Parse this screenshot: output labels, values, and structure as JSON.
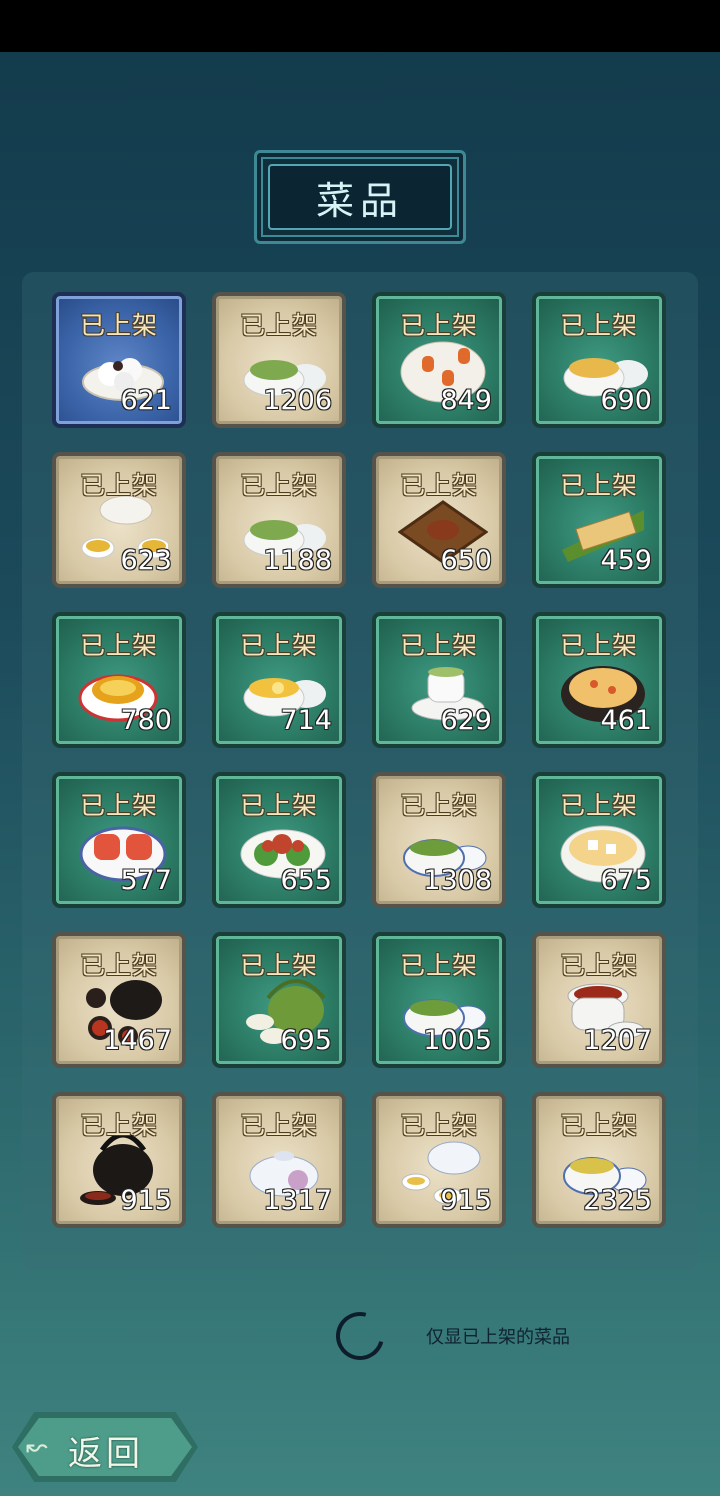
{
  "title": "菜品",
  "cards": [
    {
      "label": "已上架",
      "count": "621",
      "theme": "blue",
      "dish": "tangyuan-bowl"
    },
    {
      "label": "已上架",
      "count": "1206",
      "theme": "beige",
      "dish": "green-tea-cup"
    },
    {
      "label": "已上架",
      "count": "849",
      "theme": "green",
      "dish": "lantern-plate"
    },
    {
      "label": "已上架",
      "count": "690",
      "theme": "green",
      "dish": "soup-bowl"
    },
    {
      "label": "已上架",
      "count": "623",
      "theme": "beige",
      "dish": "tea-cups"
    },
    {
      "label": "已上架",
      "count": "1188",
      "theme": "beige",
      "dish": "green-tea-cup"
    },
    {
      "label": "已上架",
      "count": "650",
      "theme": "beige",
      "dish": "tray-dish"
    },
    {
      "label": "已上架",
      "count": "459",
      "theme": "green",
      "dish": "tofu-leaf"
    },
    {
      "label": "已上架",
      "count": "780",
      "theme": "green",
      "dish": "pudding-plate"
    },
    {
      "label": "已上架",
      "count": "714",
      "theme": "green",
      "dish": "lemon-tea-cup"
    },
    {
      "label": "已上架",
      "count": "629",
      "theme": "green",
      "dish": "tea-cup-saucer"
    },
    {
      "label": "已上架",
      "count": "461",
      "theme": "green",
      "dish": "claypot"
    },
    {
      "label": "已上架",
      "count": "577",
      "theme": "green",
      "dish": "meat-plate"
    },
    {
      "label": "已上架",
      "count": "655",
      "theme": "green",
      "dish": "flower-plate"
    },
    {
      "label": "已上架",
      "count": "1308",
      "theme": "beige",
      "dish": "blue-tea-cup"
    },
    {
      "label": "已上架",
      "count": "675",
      "theme": "green",
      "dish": "tofu-soup"
    },
    {
      "label": "已上架",
      "count": "1467",
      "theme": "beige",
      "dish": "black-teapot-set"
    },
    {
      "label": "已上架",
      "count": "695",
      "theme": "green",
      "dish": "green-teapot"
    },
    {
      "label": "已上架",
      "count": "1005",
      "theme": "green",
      "dish": "blue-tea-cup"
    },
    {
      "label": "已上架",
      "count": "1207",
      "theme": "beige",
      "dish": "red-tea-cup"
    },
    {
      "label": "已上架",
      "count": "915",
      "theme": "beige",
      "dish": "iron-kettle"
    },
    {
      "label": "已上架",
      "count": "1317",
      "theme": "beige",
      "dish": "white-teapot"
    },
    {
      "label": "已上架",
      "count": "915",
      "theme": "beige",
      "dish": "white-teapot-cups"
    },
    {
      "label": "已上架",
      "count": "2325",
      "theme": "beige",
      "dish": "yellow-tea-cup"
    }
  ],
  "filter": {
    "label": "仅显已上架的菜品"
  },
  "back": {
    "label": "返回"
  }
}
